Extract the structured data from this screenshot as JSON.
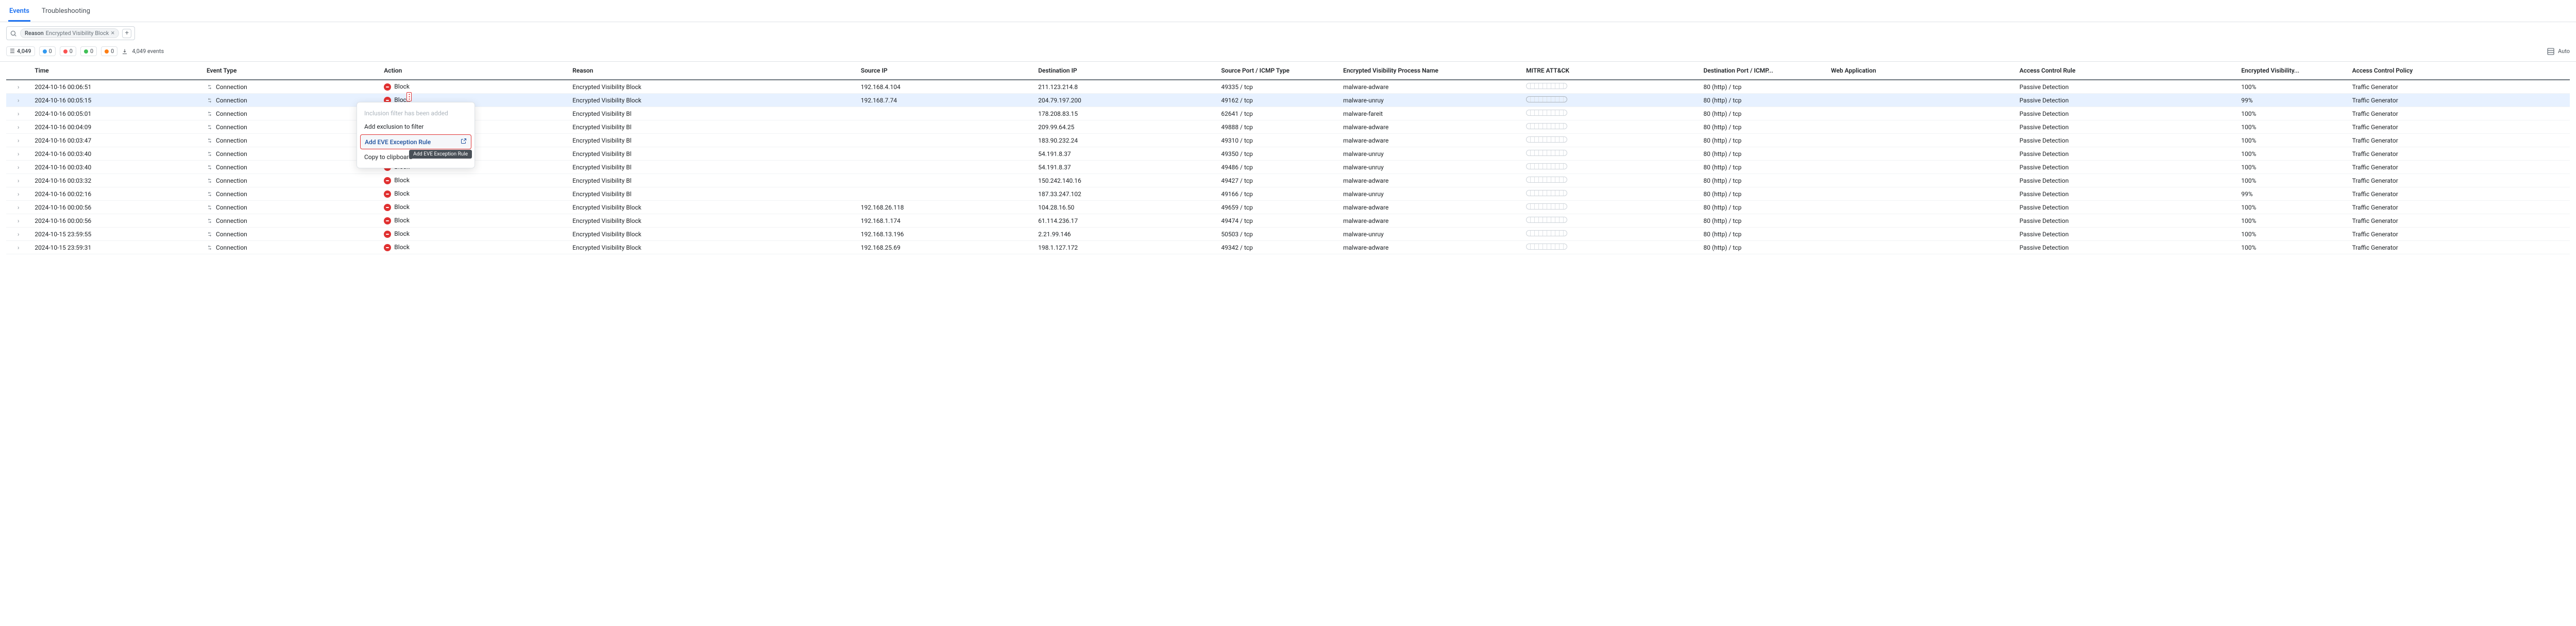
{
  "tabs": {
    "events": "Events",
    "troubleshooting": "Troubleshooting"
  },
  "filter_chip": {
    "label": "Reason",
    "value": "Encrypted Visibility Block"
  },
  "stats": {
    "total": "4,049",
    "blue": "0",
    "red": "0",
    "green": "0",
    "orange": "0",
    "events_text": "4,049 events",
    "auto": "Auto"
  },
  "headers": {
    "time": "Time",
    "event_type": "Event Type",
    "action": "Action",
    "reason": "Reason",
    "source_ip": "Source IP",
    "dest_ip": "Destination IP",
    "source_port": "Source Port / ICMP Type",
    "eve_process": "Encrypted Visibility Process Name",
    "mitre": "MITRE ATT&CK",
    "dest_port": "Destination Port / ICMP...",
    "web_app": "Web Application",
    "ac_rule": "Access Control Rule",
    "enc_vis": "Encrypted Visibility...",
    "ac_policy": "Access Control Policy"
  },
  "event_type_label": "Connection",
  "action_label": "Block",
  "context_menu": {
    "inclusion_added": "Inclusion filter has been added",
    "add_exclusion": "Add exclusion to filter",
    "add_eve_rule": "Add EVE Exception Rule",
    "copy_clipboard": "Copy to clipboard"
  },
  "tooltip": "Add EVE Exception Rule",
  "rows": [
    {
      "time": "2024-10-16 00:06:51",
      "reason": "Encrypted Visibility Block",
      "sip": "192.168.4.104",
      "dip": "211.123.214.8",
      "sport": "49335 / tcp",
      "eve": "malware-adware",
      "dport": "80 (http) / tcp",
      "rule": "Passive Detection",
      "conf": "100%",
      "policy": "Traffic Generator",
      "reason_trunc": false
    },
    {
      "time": "2024-10-16 00:05:15",
      "reason": "Encrypted Visibility Block",
      "sip": "192.168.7.74",
      "dip": "204.79.197.200",
      "sport": "49162 / tcp",
      "eve": "malware-unruy",
      "dport": "80 (http) / tcp",
      "rule": "Passive Detection",
      "conf": "99%",
      "policy": "Traffic Generator",
      "selected": true,
      "reason_trunc": false,
      "show_menu_btn": true
    },
    {
      "time": "2024-10-16 00:05:01",
      "reason": "Encrypted Visibility Bl",
      "sip": "",
      "dip": "178.208.83.15",
      "sport": "62641 / tcp",
      "eve": "malware-fareit",
      "dport": "80 (http) / tcp",
      "rule": "Passive Detection",
      "conf": "100%",
      "policy": "Traffic Generator",
      "reason_trunc": true
    },
    {
      "time": "2024-10-16 00:04:09",
      "reason": "Encrypted Visibility Bl",
      "sip": "",
      "dip": "209.99.64.25",
      "sport": "49888 / tcp",
      "eve": "malware-adware",
      "dport": "80 (http) / tcp",
      "rule": "Passive Detection",
      "conf": "100%",
      "policy": "Traffic Generator",
      "reason_trunc": true
    },
    {
      "time": "2024-10-16 00:03:47",
      "reason": "Encrypted Visibility Bl",
      "sip": "",
      "dip": "183.90.232.24",
      "sport": "49310 / tcp",
      "eve": "malware-adware",
      "dport": "80 (http) / tcp",
      "rule": "Passive Detection",
      "conf": "100%",
      "policy": "Traffic Generator",
      "reason_trunc": true
    },
    {
      "time": "2024-10-16 00:03:40",
      "reason": "Encrypted Visibility Bl",
      "sip": "",
      "dip": "54.191.8.37",
      "sport": "49350 / tcp",
      "eve": "malware-unruy",
      "dport": "80 (http) / tcp",
      "rule": "Passive Detection",
      "conf": "100%",
      "policy": "Traffic Generator",
      "reason_trunc": true
    },
    {
      "time": "2024-10-16 00:03:40",
      "reason": "Encrypted Visibility Bl",
      "sip": "",
      "dip": "54.191.8.37",
      "sport": "49486 / tcp",
      "eve": "malware-unruy",
      "dport": "80 (http) / tcp",
      "rule": "Passive Detection",
      "conf": "100%",
      "policy": "Traffic Generator",
      "reason_trunc": true
    },
    {
      "time": "2024-10-16 00:03:32",
      "reason": "Encrypted Visibility Bl",
      "sip": "",
      "dip": "150.242.140.16",
      "sport": "49427 / tcp",
      "eve": "malware-adware",
      "dport": "80 (http) / tcp",
      "rule": "Passive Detection",
      "conf": "100%",
      "policy": "Traffic Generator",
      "reason_trunc": true
    },
    {
      "time": "2024-10-16 00:02:16",
      "reason": "Encrypted Visibility Bl",
      "sip": "",
      "dip": "187.33.247.102",
      "sport": "49166 / tcp",
      "eve": "malware-unruy",
      "dport": "80 (http) / tcp",
      "rule": "Passive Detection",
      "conf": "99%",
      "policy": "Traffic Generator",
      "reason_trunc": true
    },
    {
      "time": "2024-10-16 00:00:56",
      "reason": "Encrypted Visibility Block",
      "sip": "192.168.26.118",
      "dip": "104.28.16.50",
      "sport": "49659 / tcp",
      "eve": "malware-adware",
      "dport": "80 (http) / tcp",
      "rule": "Passive Detection",
      "conf": "100%",
      "policy": "Traffic Generator",
      "reason_trunc": false
    },
    {
      "time": "2024-10-16 00:00:56",
      "reason": "Encrypted Visibility Block",
      "sip": "192.168.1.174",
      "dip": "61.114.236.17",
      "sport": "49474 / tcp",
      "eve": "malware-adware",
      "dport": "80 (http) / tcp",
      "rule": "Passive Detection",
      "conf": "100%",
      "policy": "Traffic Generator",
      "reason_trunc": false
    },
    {
      "time": "2024-10-15 23:59:55",
      "reason": "Encrypted Visibility Block",
      "sip": "192.168.13.196",
      "dip": "2.21.99.146",
      "sport": "50503 / tcp",
      "eve": "malware-unruy",
      "dport": "80 (http) / tcp",
      "rule": "Passive Detection",
      "conf": "100%",
      "policy": "Traffic Generator",
      "reason_trunc": false
    },
    {
      "time": "2024-10-15 23:59:31",
      "reason": "Encrypted Visibility Block",
      "sip": "192.168.25.69",
      "dip": "198.1.127.172",
      "sport": "49342 / tcp",
      "eve": "malware-adware",
      "dport": "80 (http) / tcp",
      "rule": "Passive Detection",
      "conf": "100%",
      "policy": "Traffic Generator",
      "reason_trunc": false
    }
  ]
}
